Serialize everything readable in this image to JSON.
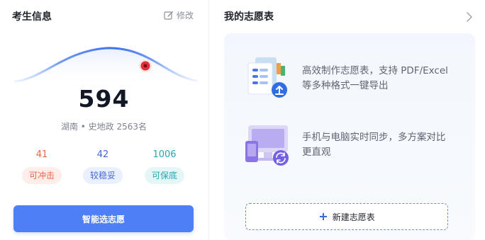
{
  "left_panel": {
    "title": "考生信息",
    "edit_label": "修改",
    "score": "594",
    "meta": "湖南 • 史地政 2563名",
    "stats": [
      {
        "count": "41",
        "label": "可冲击",
        "color": "#f0634a",
        "bg": "#fdeeea"
      },
      {
        "count": "42",
        "label": "较稳妥",
        "color": "#4169d8",
        "bg": "#eaf0fd"
      },
      {
        "count": "1006",
        "label": "可保底",
        "color": "#25a7b4",
        "bg": "#e5f6f7"
      }
    ],
    "primary_button": "智能选志愿"
  },
  "right_panel": {
    "title": "我的志愿表",
    "features": [
      {
        "icon": "document-export-icon",
        "line1": "高效制作志愿表，支持 PDF/Excel",
        "line2": "等多种格式一键导出"
      },
      {
        "icon": "device-sync-icon",
        "line1": "手机与电脑实时同步，多方案对比",
        "line2": "更直观"
      }
    ],
    "new_button": "新建志愿表"
  },
  "colors": {
    "accent": "#4f7ff5",
    "marker": "#e0303a"
  }
}
